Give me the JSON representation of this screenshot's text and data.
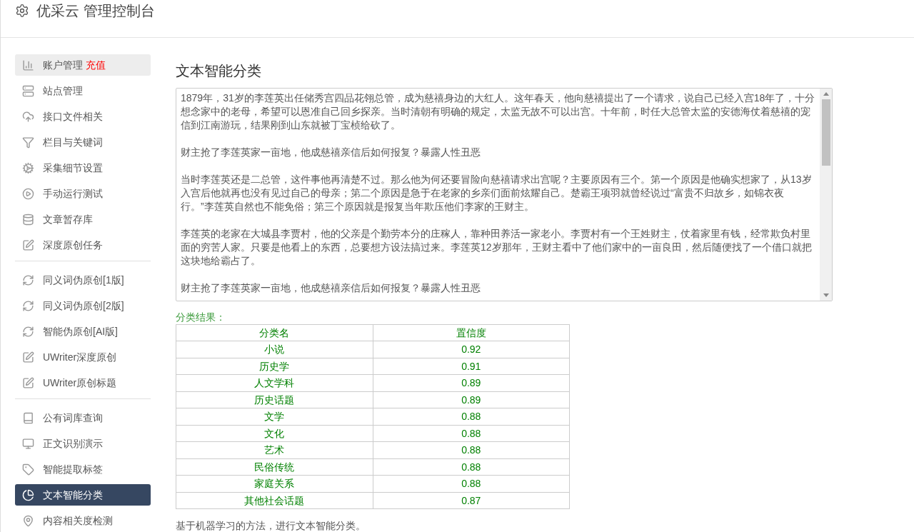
{
  "header": {
    "title": "优采云 管理控制台"
  },
  "sidebar": {
    "groups": [
      [
        {
          "label": "账户管理",
          "badge": "充值",
          "selected": false,
          "hover": true
        },
        {
          "label": "站点管理",
          "selected": false
        },
        {
          "label": "接口文件相关",
          "selected": false
        },
        {
          "label": "栏目与关键词",
          "selected": false
        },
        {
          "label": "采集细节设置",
          "selected": false
        },
        {
          "label": "手动运行测试",
          "selected": false
        },
        {
          "label": "文章暂存库",
          "selected": false
        },
        {
          "label": "深度原创任务",
          "selected": false
        }
      ],
      [
        {
          "label": "同义词伪原创[1版]",
          "selected": false
        },
        {
          "label": "同义词伪原创[2版]",
          "selected": false
        },
        {
          "label": "智能伪原创[AI版]",
          "selected": false
        },
        {
          "label": "UWriter深度原创",
          "selected": false
        },
        {
          "label": "UWriter原创标题",
          "selected": false
        }
      ],
      [
        {
          "label": "公有词库查询",
          "selected": false
        },
        {
          "label": "正文识别演示",
          "selected": false
        },
        {
          "label": "智能提取标签",
          "selected": false
        },
        {
          "label": "文本智能分类",
          "selected": true
        },
        {
          "label": "内容相关度检测",
          "selected": false
        }
      ]
    ]
  },
  "main": {
    "title": "文本智能分类",
    "textarea": {
      "paragraphs": [
        "1879年，31岁的李莲英出任储秀宫四品花翎总管，成为慈禧身边的大红人。这年春天，他向慈禧提出了一个请求，说自己已经入宫18年了，十分想念家中的老母，希望可以恩准自己回乡探亲。当时清朝有明确的规定，太监无故不可以出宫。十年前，时任大总管太监的安德海仗着慈禧的宠信到江南游玩，结果刚到山东就被丁宝桢给砍了。",
        "财主抢了李莲英家一亩地，他成慈禧亲信后如何报复？暴露人性丑恶",
        "当时李莲英还是二总管，这件事他再清楚不过。那么他为何还要冒险向慈禧请求出宫呢？主要原因有三个。第一个原因是他确实想家了，从13岁入宫后他就再也没有见过自己的母亲；第二个原因是急于在老家的乡亲们面前炫耀自己。楚霸王项羽就曾经说过“富贵不归故乡，如锦衣夜行。”李莲英自然也不能免俗；第三个原因就是报复当年欺压他们李家的王财主。",
        "李莲英的老家在大城县李贾村，他的父亲是个勤劳本分的庄稼人，靠种田养活一家老小。李贾村有一个王姓财主，仗着家里有钱，经常欺负村里面的穷苦人家。只要是他看上的东西，总要想方设法搞过来。李莲英12岁那年，王财主看中了他们家中的一亩良田，然后随便找了一个借口就把这块地给霸占了。",
        "财主抢了李莲英家一亩地，他成慈禧亲信后如何报复？暴露人性丑恶"
      ]
    },
    "result_label": "分类结果：",
    "table": {
      "columns": [
        "分类名",
        "置信度"
      ],
      "rows": [
        [
          "小说",
          "0.92"
        ],
        [
          "历史学",
          "0.91"
        ],
        [
          "人文学科",
          "0.89"
        ],
        [
          "历史话题",
          "0.89"
        ],
        [
          "文学",
          "0.88"
        ],
        [
          "文化",
          "0.88"
        ],
        [
          "艺术",
          "0.88"
        ],
        [
          "民俗传统",
          "0.88"
        ],
        [
          "家庭关系",
          "0.88"
        ],
        [
          "其他社会话题",
          "0.87"
        ]
      ]
    },
    "footer_note": "基于机器学习的方法，进行文本智能分类。"
  }
}
